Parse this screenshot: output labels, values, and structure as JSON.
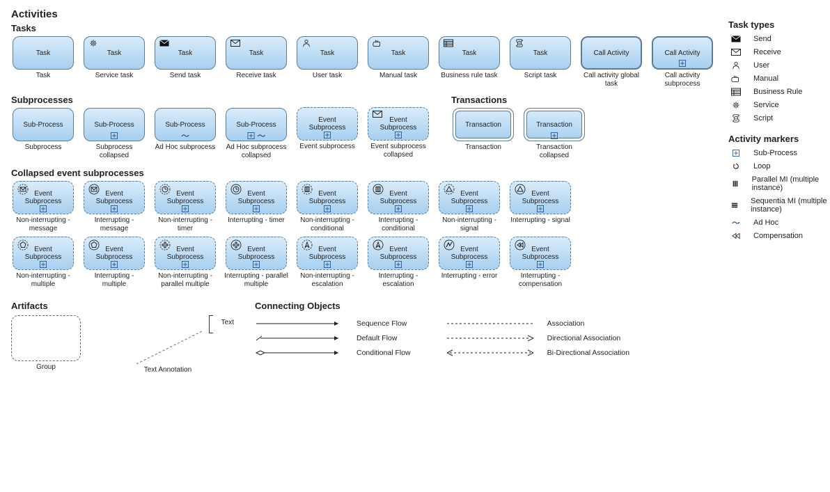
{
  "titles": {
    "activities": "Activities",
    "tasks": "Tasks",
    "subprocesses": "Subprocesses",
    "transactions": "Transactions",
    "collapsed": "Collapsed event subprocesses",
    "artifacts": "Artifacts",
    "connecting": "Connecting Objects",
    "taskTypes": "Task types",
    "activityMarkers": "Activity markers"
  },
  "taskRow": [
    {
      "label": "Task",
      "caption": "Task",
      "icon": "none"
    },
    {
      "label": "Task",
      "caption": "Service task",
      "icon": "service"
    },
    {
      "label": "Task",
      "caption": "Send task",
      "icon": "send"
    },
    {
      "label": "Task",
      "caption": "Receive task",
      "icon": "receive"
    },
    {
      "label": "Task",
      "caption": "User task",
      "icon": "user"
    },
    {
      "label": "Task",
      "caption": "Manual task",
      "icon": "manual"
    },
    {
      "label": "Task",
      "caption": "Business rule task",
      "icon": "brule"
    },
    {
      "label": "Task",
      "caption": "Script task",
      "icon": "script"
    },
    {
      "label": "Call Activity",
      "caption": "Call activity global task",
      "icon": "none",
      "thick": true
    },
    {
      "label": "Call Activity",
      "caption": "Call activity subprocess",
      "icon": "none",
      "thick": true,
      "marker": "sub"
    }
  ],
  "subprocessRow": [
    {
      "label": "Sub-Process",
      "caption": "Subprocess"
    },
    {
      "label": "Sub-Process",
      "caption": "Subprocess collapsed",
      "marker": "sub"
    },
    {
      "label": "Sub-Process",
      "caption": "Ad Hoc subprocess",
      "marker": "adhoc"
    },
    {
      "label": "Sub-Process",
      "caption": "Ad Hoc subprocess collapsed",
      "marker": "sub-adhoc"
    }
  ],
  "eventSubprocessRow": [
    {
      "label": "Event Subprocess",
      "caption": "Event subprocess",
      "dashed": true,
      "marker": "sub"
    },
    {
      "label": "Event Subprocess",
      "caption": "Event subprocess collapsed",
      "dashed": true,
      "icon": "receive",
      "marker": "sub"
    }
  ],
  "transactionRow": [
    {
      "label": "Transaction",
      "caption": "Transaction",
      "double": true
    },
    {
      "label": "Transaction",
      "caption": "Transaction collapsed",
      "double": true,
      "marker": "sub"
    }
  ],
  "collapsedRow1": [
    {
      "label": "Event Subprocess",
      "caption": "Non-interrupting - message",
      "dashed": true,
      "icon": "msg-ni",
      "marker": "sub"
    },
    {
      "label": "Event Subprocess",
      "caption": "Interrupting - message",
      "dashed": true,
      "icon": "msg-i",
      "marker": "sub"
    },
    {
      "label": "Event Subprocess",
      "caption": "Non-interrupting - timer",
      "dashed": true,
      "icon": "timer-ni",
      "marker": "sub"
    },
    {
      "label": "Event Subprocess",
      "caption": "Interrupting - timer",
      "dashed": true,
      "icon": "timer-i",
      "marker": "sub"
    },
    {
      "label": "Event Subprocess",
      "caption": "Non-interrupting - conditional",
      "dashed": true,
      "icon": "cond-ni",
      "marker": "sub"
    },
    {
      "label": "Event Subprocess",
      "caption": "Interrupting - conditional",
      "dashed": true,
      "icon": "cond-i",
      "marker": "sub"
    },
    {
      "label": "Event Subprocess",
      "caption": "Non-interrupting - signal",
      "dashed": true,
      "icon": "sig-ni",
      "marker": "sub"
    },
    {
      "label": "Event Subprocess",
      "caption": "Interrupting - signal",
      "dashed": true,
      "icon": "sig-i",
      "marker": "sub"
    }
  ],
  "collapsedRow2": [
    {
      "label": "Event Subprocess",
      "caption": "Non-interrupting - multiple",
      "dashed": true,
      "icon": "mult-ni",
      "marker": "sub"
    },
    {
      "label": "Event Subprocess",
      "caption": "Interrupting - multiple",
      "dashed": true,
      "icon": "mult-i",
      "marker": "sub"
    },
    {
      "label": "Event Subprocess",
      "caption": "Non-interrupting - parallel multiple",
      "dashed": true,
      "icon": "parmult-ni",
      "marker": "sub"
    },
    {
      "label": "Event Subprocess",
      "caption": "Interrupting - parallel multiple",
      "dashed": true,
      "icon": "parmult-i",
      "marker": "sub"
    },
    {
      "label": "Event Subprocess",
      "caption": "Non-interrupting - escalation",
      "dashed": true,
      "icon": "esc-ni",
      "marker": "sub"
    },
    {
      "label": "Event Subprocess",
      "caption": "Interrupting - escalation",
      "dashed": true,
      "icon": "esc-i",
      "marker": "sub"
    },
    {
      "label": "Event Subprocess",
      "caption": "Interrupting - error",
      "dashed": true,
      "icon": "err-i",
      "marker": "sub"
    },
    {
      "label": "Event Subprocess",
      "caption": "Interrupting - compensation",
      "dashed": true,
      "icon": "comp-i",
      "marker": "sub"
    }
  ],
  "artifacts": {
    "group": "Group",
    "textAnnotation": "Text Annotation",
    "textLabel": "Text"
  },
  "connecting": [
    {
      "name": "Sequence Flow",
      "kind": "seq"
    },
    {
      "name": "Default Flow",
      "kind": "def"
    },
    {
      "name": "Conditional Flow",
      "kind": "cond"
    }
  ],
  "connecting2": [
    {
      "name": "Association",
      "kind": "assoc"
    },
    {
      "name": "Directional Association",
      "kind": "dassoc"
    },
    {
      "name": "Bi-Directional Association",
      "kind": "bassoc"
    }
  ],
  "taskTypes": [
    {
      "icon": "send",
      "label": "Send"
    },
    {
      "icon": "receive",
      "label": "Receive"
    },
    {
      "icon": "user",
      "label": "User"
    },
    {
      "icon": "manual",
      "label": "Manual"
    },
    {
      "icon": "brule",
      "label": "Business Rule"
    },
    {
      "icon": "service",
      "label": "Service"
    },
    {
      "icon": "script",
      "label": "Script"
    }
  ],
  "activityMarkers": [
    {
      "icon": "sub",
      "label": "Sub-Process"
    },
    {
      "icon": "loop",
      "label": "Loop"
    },
    {
      "icon": "pmi",
      "label": "Parallel MI (multiple instance)"
    },
    {
      "icon": "smi",
      "label": "Sequentia MI (multiple instance)"
    },
    {
      "icon": "adhoc",
      "label": "Ad Hoc"
    },
    {
      "icon": "comp",
      "label": "Compensation"
    }
  ]
}
